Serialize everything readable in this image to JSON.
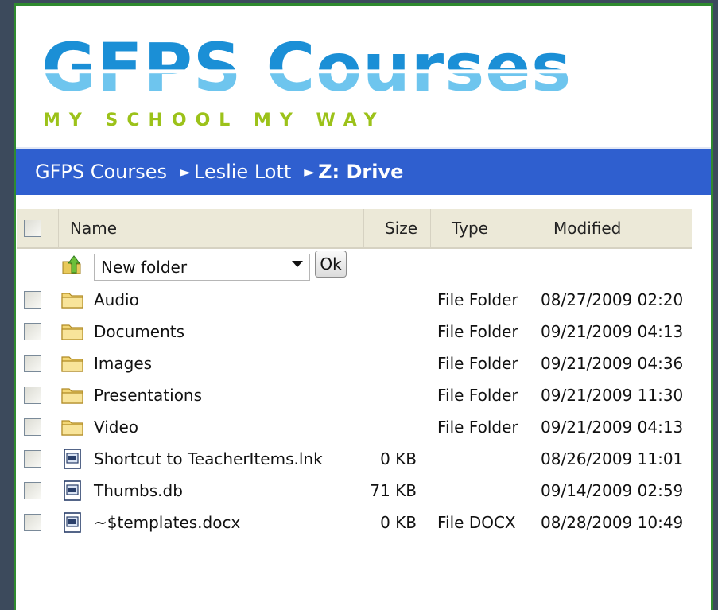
{
  "logo": {
    "title": "GFPS Courses",
    "tagline": "MY SCHOOL MY WAY",
    "colors": {
      "title_top": "#1b8fd6",
      "title_bottom": "#6ec5ee",
      "tagline": "#9cc21a"
    }
  },
  "breadcrumb": {
    "items": [
      "GFPS Courses",
      "Leslie Lott",
      "Z: Drive"
    ],
    "separator": "►"
  },
  "table": {
    "columns": [
      "Name",
      "Size",
      "Type",
      "Modified"
    ],
    "new_folder": {
      "value": "New folder",
      "ok_label": "Ok"
    },
    "rows": [
      {
        "icon": "folder-icon",
        "name": "Audio",
        "size": "",
        "type": "File Folder",
        "modified": "08/27/2009 02:20"
      },
      {
        "icon": "folder-icon",
        "name": "Documents",
        "size": "",
        "type": "File Folder",
        "modified": "09/21/2009 04:13"
      },
      {
        "icon": "folder-icon",
        "name": "Images",
        "size": "",
        "type": "File Folder",
        "modified": "09/21/2009 04:36"
      },
      {
        "icon": "folder-icon",
        "name": "Presentations",
        "size": "",
        "type": "File Folder",
        "modified": "09/21/2009 11:30"
      },
      {
        "icon": "folder-icon",
        "name": "Video",
        "size": "",
        "type": "File Folder",
        "modified": "09/21/2009 04:13"
      },
      {
        "icon": "file-icon",
        "name": "Shortcut to TeacherItems.lnk",
        "size": "0 KB",
        "type": "",
        "modified": "08/26/2009 11:01"
      },
      {
        "icon": "file-icon",
        "name": "Thumbs.db",
        "size": "71 KB",
        "type": "",
        "modified": "09/14/2009 02:59"
      },
      {
        "icon": "file-icon",
        "name": "~$templates.docx",
        "size": "0 KB",
        "type": "File DOCX",
        "modified": "08/28/2009 10:49"
      }
    ]
  },
  "colors": {
    "breadcrumb_bar": "#2f5fcf",
    "header_bg": "#ece9d8",
    "frame_border": "#2f8a2f"
  }
}
